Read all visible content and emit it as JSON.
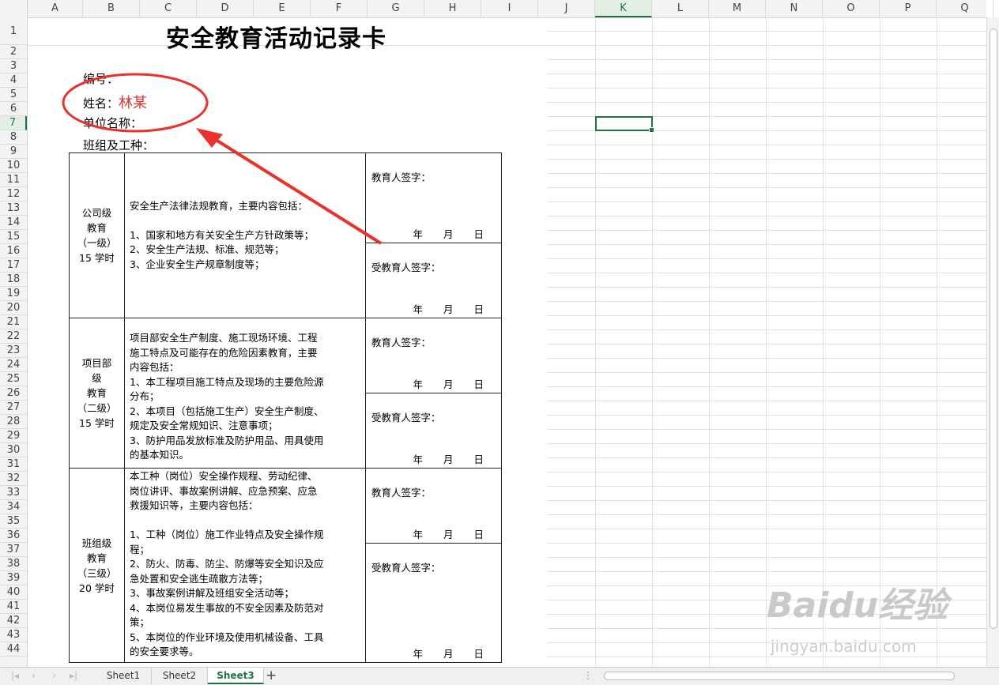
{
  "columns": [
    "A",
    "B",
    "C",
    "D",
    "E",
    "F",
    "G",
    "H",
    "I",
    "J",
    "K",
    "L",
    "M",
    "N",
    "O",
    "P",
    "Q"
  ],
  "selected_column": "K",
  "rows": [
    "1",
    "2",
    "3",
    "4",
    "5",
    "6",
    "7",
    "8",
    "9",
    "10",
    "11",
    "12",
    "13",
    "14",
    "15",
    "16",
    "17",
    "18",
    "19",
    "20",
    "21",
    "22",
    "23",
    "24",
    "25",
    "26",
    "27",
    "28",
    "29",
    "30",
    "31",
    "32",
    "33",
    "34",
    "35",
    "36",
    "37",
    "38",
    "39",
    "40",
    "41",
    "42",
    "43",
    "44"
  ],
  "selected_row": "7",
  "title": "安全教育活动记录卡",
  "fields": {
    "number_label": "编号：",
    "name_label": "姓名：",
    "name_value": "林某",
    "unit_label": "单位名称：",
    "team_label": "班组及工种："
  },
  "levels": [
    {
      "label": [
        "公司级",
        "教育",
        "（一级）",
        "15 学时"
      ],
      "content": [
        "安全生产法律法规教育，主要内容包括：",
        "",
        "1、国家和地方有关安全生产方针政策等；",
        "2、安全生产法规、标准、规范等；",
        "3、企业安全生产规章制度等；"
      ],
      "educator": "教育人签字：",
      "trainee": "受教育人签字：",
      "date": "年 月 日"
    },
    {
      "label": [
        "项目部",
        "级",
        "教育",
        "（二级）",
        "15 学时"
      ],
      "content": [
        "项目部安全生产制度、施工现场环境、工程",
        "施工特点及可能存在的危险因素教育，主要",
        "内容包括：",
        "1、本工程项目施工特点及现场的主要危险源",
        "分布；",
        "2、本项目（包括施工生产）安全生产制度、",
        "规定及安全常规知识、注意事项；",
        "3、防护用品发放标准及防护用品、用具使用",
        "的基本知识。"
      ],
      "educator": "教育人签字：",
      "trainee": "受教育人签字：",
      "date": "年 月 日"
    },
    {
      "label": [
        "班组级",
        "教育",
        "（三级）",
        "20 学时"
      ],
      "content": [
        "本工种（岗位）安全操作规程、劳动纪律、",
        "岗位讲评、事故案例讲解、应急预案、应急",
        "救援知识等，主要内容包括：",
        "",
        "1、工种（岗位）施工作业特点及安全操作规",
        "程；",
        "2、防火、防毒、防尘、防爆等安全知识及应",
        "急处置和安全逃生疏散方法等；",
        "3、事故案例讲解及班组安全活动等；",
        "4、本岗位易发生事故的不安全因素及防范对",
        "策；",
        "5、本岗位的作业环境及使用机械设备、工具",
        "的安全要求等。"
      ],
      "educator": "教育人签字：",
      "trainee": "受教育人签字：",
      "date": "年 月 日"
    }
  ],
  "sheets": [
    "Sheet1",
    "Sheet2",
    "Sheet3"
  ],
  "active_sheet": "Sheet3",
  "watermark": "Baidu经验",
  "watermark_url": "jingyan.baidu.com",
  "annotation_color": "#e8322b",
  "accent_color": "#217346"
}
